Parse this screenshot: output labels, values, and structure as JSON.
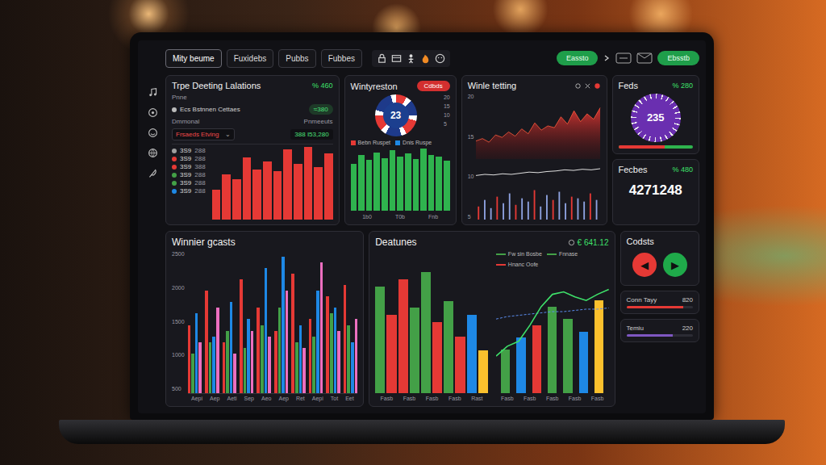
{
  "nav": {
    "tabs": [
      {
        "label": "Mity beume",
        "selected": true
      },
      {
        "label": "Fuxidebs",
        "selected": false
      },
      {
        "label": "Pubbs",
        "selected": false
      },
      {
        "label": "Fubbes",
        "selected": false
      }
    ],
    "actions": [
      "Eassto",
      "Ebsstb"
    ]
  },
  "betting": {
    "title": "Trpe Deeting Lalations",
    "value": "% 460",
    "sub_label": "Pnne",
    "sub_text": "Ecs Bstnnen Cettaes",
    "pill": "≈380",
    "left_label": "Dmmonal",
    "right_label": "Pnmeeuts",
    "select": "Frsaeds Etving",
    "select_value": "388 I53,280",
    "rows": [
      {
        "code": "3S9",
        "value": "288",
        "color": "#9e9e9e"
      },
      {
        "code": "3S9",
        "value": "288",
        "color": "#e53935"
      },
      {
        "code": "3S9",
        "value": "388",
        "color": "#e53935"
      },
      {
        "code": "3S9",
        "value": "288",
        "color": "#43a047"
      },
      {
        "code": "3S9",
        "value": "288",
        "color": "#43a047"
      },
      {
        "code": "3S9",
        "value": "288",
        "color": "#1e88e5"
      }
    ],
    "bars": [
      30,
      45,
      40,
      62,
      50,
      58,
      48,
      70,
      55,
      72,
      52,
      66
    ]
  },
  "roulette": {
    "title": "Wintyreston",
    "badge": "Cdbds",
    "number": "23",
    "legend": [
      "Bebn Ruspet",
      "Dnis Ruspe"
    ],
    "y_ticks": [
      "20",
      "15",
      "10",
      "5"
    ],
    "x_ticks": [
      "1b0",
      "T0b",
      "Fnb"
    ],
    "bars": [
      60,
      72,
      65,
      75,
      68,
      78,
      70,
      74,
      66,
      80,
      72,
      70,
      64
    ]
  },
  "winnings": {
    "title": "Winle tetting",
    "y_ticks": [
      "20",
      "15",
      "10",
      "5"
    ],
    "area": [
      30,
      34,
      28,
      40,
      36,
      45,
      38,
      50,
      42,
      60,
      48,
      55,
      52,
      70,
      58,
      80,
      62,
      75,
      66,
      85
    ],
    "line": [
      20,
      22,
      21,
      23,
      22,
      24,
      26,
      25,
      27,
      28,
      30,
      29,
      31,
      30,
      32
    ],
    "spikes": [
      40,
      60,
      35,
      70,
      50,
      80,
      45,
      65,
      55,
      90,
      40,
      75,
      60,
      85,
      50,
      70,
      65,
      55,
      80,
      60
    ]
  },
  "gauge": {
    "title": "Feds",
    "value": "% 280",
    "number": "235",
    "level": 0.62
  },
  "total": {
    "title": "Fecbes",
    "value": "% 480",
    "number": "4271248"
  },
  "winner": {
    "title": "Winnier gcasts",
    "y_ticks": [
      "2500",
      "2000",
      "1500",
      "1000",
      "500"
    ],
    "x_ticks": [
      "Aepi",
      "Aep",
      "Aeti",
      "Sep",
      "Aeo",
      "Aep",
      "Ret",
      "Aepi",
      "Tot",
      "Eet"
    ],
    "series": [
      {
        "color": "#e53935",
        "values": [
          1200,
          1800,
          900,
          2000,
          1500,
          1100,
          2100,
          1300,
          1700,
          1900
        ]
      },
      {
        "color": "#43a047",
        "values": [
          700,
          900,
          1100,
          800,
          1200,
          1500,
          900,
          1000,
          1400,
          1200
        ]
      },
      {
        "color": "#1e88e5",
        "values": [
          1400,
          1000,
          1600,
          1300,
          2200,
          2400,
          1200,
          1800,
          1500,
          900
        ]
      },
      {
        "color": "#ec6fc0",
        "values": [
          900,
          1500,
          700,
          1100,
          1000,
          1800,
          800,
          2300,
          1100,
          1300
        ]
      }
    ]
  },
  "features": {
    "title": "Deatunes",
    "value": "€ 641.12",
    "legend": [
      {
        "label": "Fw sin Bosbe",
        "color": "#43a047"
      },
      {
        "label": "Fnnase",
        "color": "#43a047"
      },
      {
        "label": "Hnanc Oofe",
        "color": "#e53935"
      }
    ],
    "x_ticks_left": [
      "Fasb",
      "Fasb",
      "Fasb",
      "Fasb",
      "Rast"
    ],
    "x_ticks_right": [
      "Fasb",
      "Fasb",
      "Fasb",
      "Fasb",
      "Fasb"
    ],
    "bars_left": [
      {
        "value": 75,
        "color": "#43a047"
      },
      {
        "value": 55,
        "color": "#e53935"
      },
      {
        "value": 80,
        "color": "#e53935"
      },
      {
        "value": 60,
        "color": "#43a047"
      },
      {
        "value": 85,
        "color": "#43a047"
      },
      {
        "value": 50,
        "color": "#e53935"
      },
      {
        "value": 65,
        "color": "#43a047"
      },
      {
        "value": 40,
        "color": "#e53935"
      },
      {
        "value": 55,
        "color": "#1e88e5"
      },
      {
        "value": 30,
        "color": "#fbc02d"
      }
    ],
    "bars_right": [
      {
        "value": 35,
        "color": "#43a047"
      },
      {
        "value": 45,
        "color": "#1e88e5"
      },
      {
        "value": 55,
        "color": "#e53935"
      },
      {
        "value": 70,
        "color": "#43a047"
      },
      {
        "value": 60,
        "color": "#43a047"
      },
      {
        "value": 50,
        "color": "#1e88e5"
      },
      {
        "value": 75,
        "color": "#fbc02d"
      }
    ],
    "line": [
      30,
      38,
      42,
      55,
      70,
      80,
      82,
      78,
      75,
      80,
      84
    ],
    "dashed": [
      60,
      62,
      63,
      64,
      65,
      66,
      66,
      67,
      68,
      68,
      69
    ]
  },
  "controls": {
    "title": "Codsts",
    "prev": "◀",
    "next": "▶",
    "rows": [
      {
        "label": "Conn Tayy",
        "value": "820",
        "level": 0.85,
        "color": "#e53935"
      },
      {
        "label": "Temiu",
        "value": "220",
        "level": 0.7,
        "color": "#7e57c2"
      }
    ]
  }
}
